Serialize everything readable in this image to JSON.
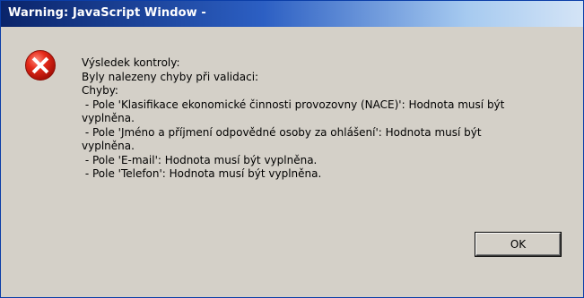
{
  "window": {
    "title": "Warning: JavaScript Window -"
  },
  "icon": {
    "name": "error-icon",
    "color": "#cc1111"
  },
  "message": {
    "lines": [
      "Výsledek kontroly:",
      "Byly nalezeny chyby při validaci:",
      "Chyby:",
      " - Pole 'Klasifikace ekonomické činnosti provozovny (NACE)': Hodnota musí být",
      "vyplněna.",
      " - Pole 'Jméno a příjmení odpovědné osoby za ohlášení': Hodnota musí být",
      "vyplněna.",
      " - Pole 'E-mail': Hodnota musí být vyplněna.",
      " - Pole 'Telefon': Hodnota musí být vyplněna."
    ]
  },
  "buttons": {
    "ok_label": "OK"
  }
}
